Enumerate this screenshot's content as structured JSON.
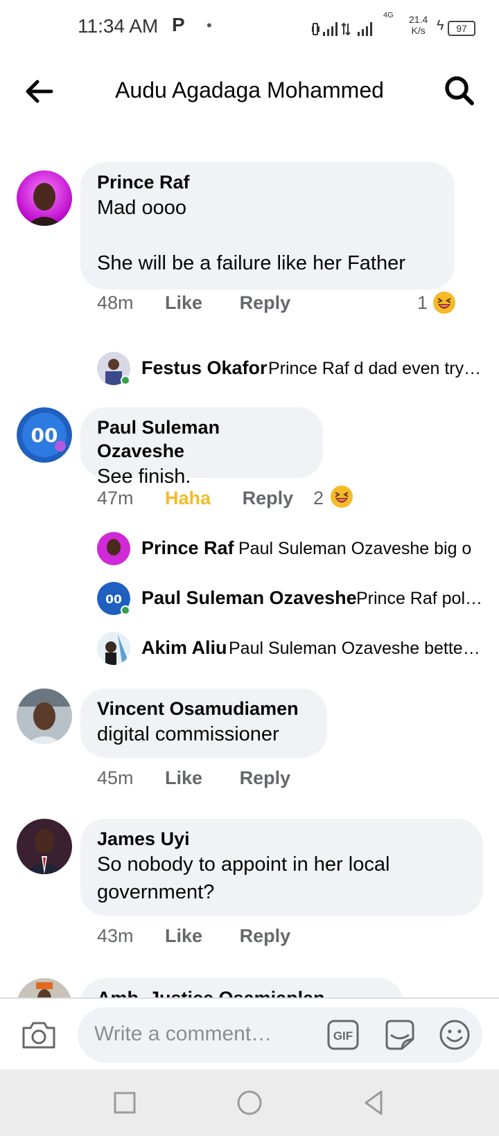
{
  "status_bar": {
    "time": "11:34 AM",
    "p_icon": "P",
    "dot": "•",
    "network_type": "4G",
    "speed_value": "21.4",
    "speed_unit": "K/s",
    "battery": "97"
  },
  "header": {
    "title": "Audu Agadaga Mohammed",
    "back_icon": "back-arrow-icon",
    "search_icon": "search-icon"
  },
  "comments": [
    {
      "name": "Prince Raf",
      "text": "Mad oooo\n\nShe will be a failure like her Father",
      "time": "48m",
      "action": "Like",
      "reply": "Reply",
      "reaction_count": "1",
      "reaction": "laughing-emoji",
      "replies": [
        {
          "name": "Festus Okafor",
          "text": "Prince Raf d dad even try…",
          "online": true
        }
      ]
    },
    {
      "name": "Paul Suleman Ozaveshe",
      "text": "See finish.",
      "time": "47m",
      "action": "Haha",
      "action_color": "#f7b928",
      "reply": "Reply",
      "reaction_count": "2",
      "reaction": "laughing-emoji",
      "replies": [
        {
          "name": "Prince Raf",
          "text": "Paul Suleman Ozaveshe big o",
          "online": false
        },
        {
          "name": "Paul Suleman Ozaveshe",
          "text": "Prince Raf pol…",
          "online": true
        },
        {
          "name": "Akim Aliu",
          "text": "Paul Suleman Ozaveshe bette…",
          "online": false
        }
      ]
    },
    {
      "name": "Vincent Osamudiamen",
      "text": "digital commissioner",
      "time": "45m",
      "action": "Like",
      "reply": "Reply"
    },
    {
      "name": "James Uyi",
      "text": "So nobody to appoint in her local government?",
      "time": "43m",
      "action": "Like",
      "reply": "Reply"
    },
    {
      "name": "Amb. Justice Osamiaplan Godfrey"
    }
  ],
  "composer": {
    "placeholder": "Write a comment…",
    "gif_label": "GIF"
  },
  "colors": {
    "bubble": "#f0f2f5",
    "secondary_text": "#65676b",
    "haha": "#f7b928",
    "online": "#31a24c"
  }
}
